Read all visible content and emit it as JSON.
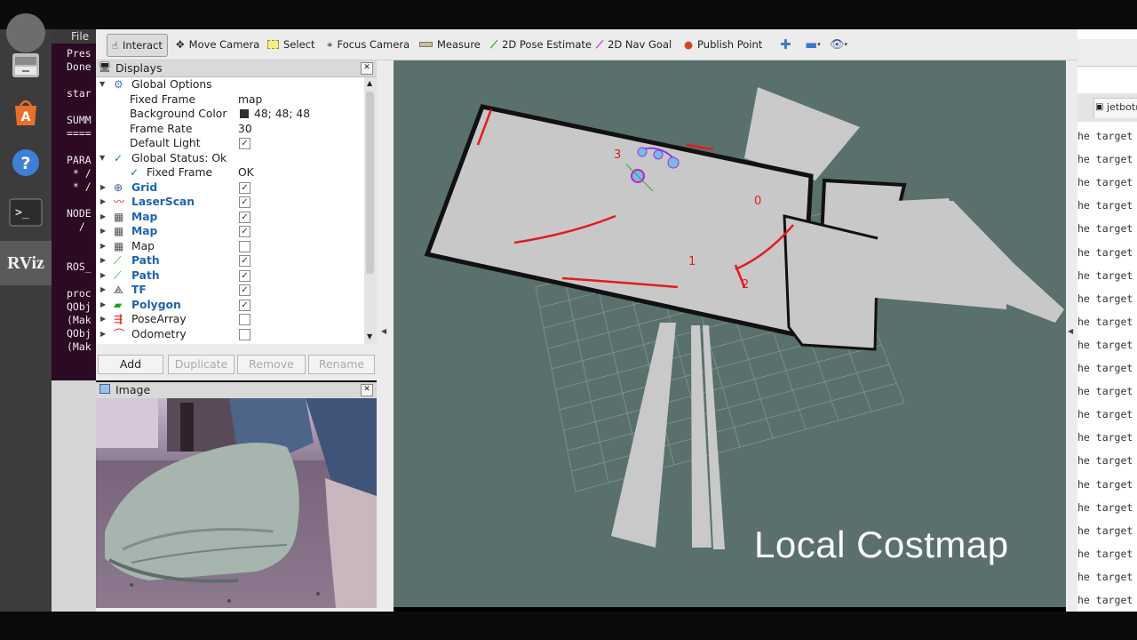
{
  "window": {
    "menu_file": "File"
  },
  "toolbar": {
    "interact": "Interact",
    "move_camera": "Move Camera",
    "select": "Select",
    "focus_camera": "Focus Camera",
    "measure": "Measure",
    "pose_estimate": "2D Pose Estimate",
    "nav_goal": "2D Nav Goal",
    "publish_point": "Publish Point"
  },
  "launcher": {
    "rviz_label": "RViz"
  },
  "terminal_left": {
    "lines": [
      "Pres",
      "Done",
      "",
      "star",
      "",
      "SUMM",
      "====",
      "",
      "PARA",
      " * /",
      " * /",
      "",
      "NODE",
      "  /",
      "",
      "",
      "ROS_",
      "",
      "proc",
      "QObj",
      "(Mak",
      "QObj",
      "(Mak"
    ]
  },
  "displays_panel": {
    "title": "Displays",
    "global_options": "Global Options",
    "fixed_frame_label": "Fixed Frame",
    "fixed_frame_value": "map",
    "background_color_label": "Background Color",
    "background_color_value": "48; 48; 48",
    "frame_rate_label": "Frame Rate",
    "frame_rate_value": "30",
    "default_light_label": "Default Light",
    "global_status": "Global Status: Ok",
    "status_fixed_frame_label": "Fixed Frame",
    "status_fixed_frame_value": "OK",
    "items": [
      {
        "name": "Grid",
        "checked": true,
        "blue": true
      },
      {
        "name": "LaserScan",
        "checked": true,
        "blue": true
      },
      {
        "name": "Map",
        "checked": true,
        "blue": true
      },
      {
        "name": "Map",
        "checked": true,
        "blue": true
      },
      {
        "name": "Map",
        "checked": false,
        "blue": false
      },
      {
        "name": "Path",
        "checked": true,
        "blue": true
      },
      {
        "name": "Path",
        "checked": true,
        "blue": true
      },
      {
        "name": "TF",
        "checked": true,
        "blue": true
      },
      {
        "name": "Polygon",
        "checked": true,
        "blue": true
      },
      {
        "name": "PoseArray",
        "checked": false,
        "blue": false
      },
      {
        "name": "Odometry",
        "checked": false,
        "blue": false
      }
    ],
    "add_button": "Add",
    "duplicate_button": "Duplicate",
    "remove_button": "Remove",
    "rename_button": "Rename"
  },
  "image_panel": {
    "title": "Image"
  },
  "view3d": {
    "overlay_text": "Local Costmap",
    "frame_labels": [
      "0",
      "1",
      "2",
      "3"
    ],
    "background_color": "#59706c"
  },
  "terminal_right": {
    "tab_label": "jetbot@",
    "line_text": "he target p",
    "line_count": 21
  }
}
